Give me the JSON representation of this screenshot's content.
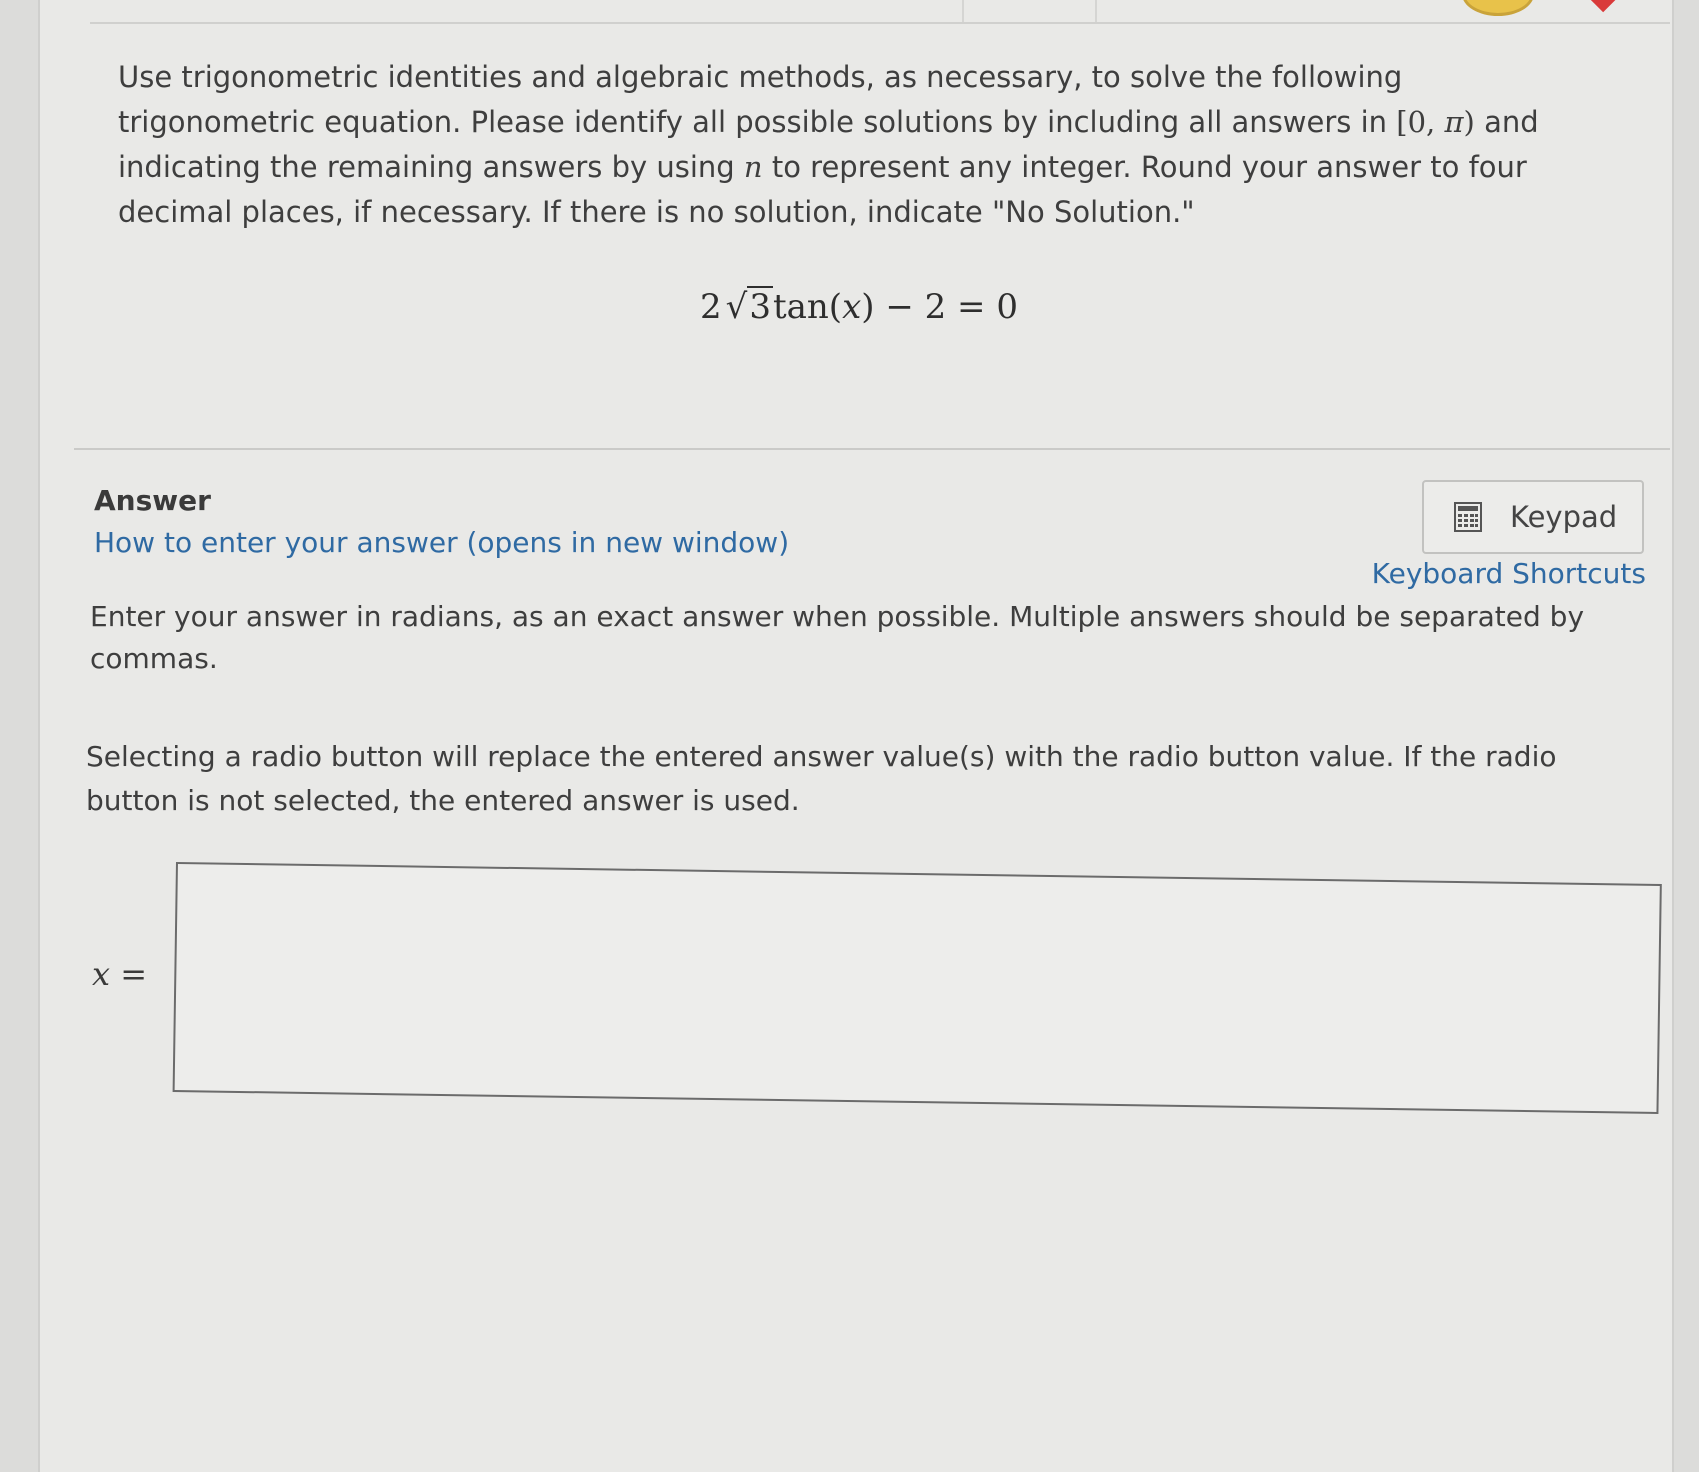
{
  "question": {
    "part1": "Use trigonometric identities and algebraic methods, as necessary, to solve the following trigonometric equation. Please identify all possible solutions by including all answers in ",
    "interval_open": "[0, ",
    "interval_pi": "π",
    "interval_close": ")",
    "part2": " and indicating the remaining answers by using ",
    "n_var": "n",
    "part3": " to represent any integer. Round your answer to four decimal places, if necessary. If there is no solution, indicate \"No Solution.\""
  },
  "equation": {
    "coefficient": "2",
    "radical_symbol": "√",
    "radicand": "3",
    "rest_before_var": "tan(",
    "variable": "x",
    "rest_after_var": ") − 2 = 0"
  },
  "answer": {
    "heading": "Answer",
    "help_link": "How to enter your answer (opens in new window)",
    "keypad_label": "Keypad",
    "keypad_icon": "calculator-icon",
    "shortcuts_link": "Keyboard Shortcuts",
    "instructions": "Enter your answer in radians, as an exact answer when possible. Multiple answers should be separated by commas.",
    "radio_note": "Selecting a radio button will replace the entered answer value(s) with the radio button value. If the radio button is not selected, the entered answer is used.",
    "input_label_var": "x",
    "input_label_eq": " =",
    "input_value": ""
  },
  "colors": {
    "link": "#2f6aa3",
    "text": "#3e3e3e",
    "panel_bg": "#e9e9e7"
  }
}
